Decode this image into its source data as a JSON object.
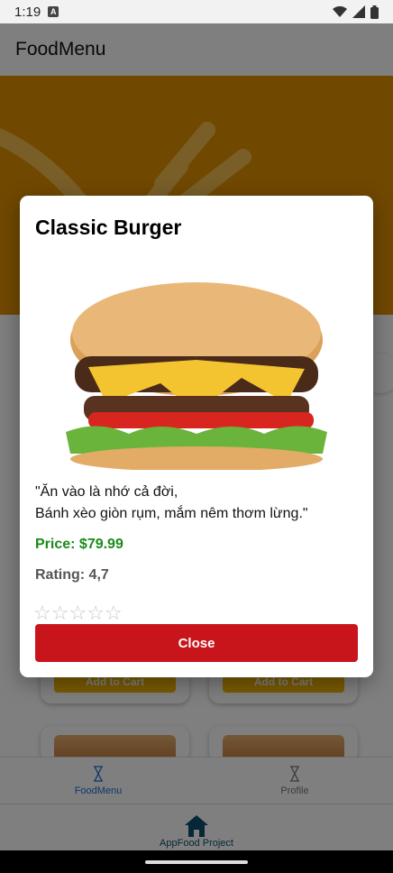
{
  "status_bar": {
    "time": "1:19",
    "notification_icon": "A"
  },
  "app_bar": {
    "title": "FoodMenu"
  },
  "background_cards": {
    "add_to_cart_label": "Add to Cart"
  },
  "tabs": [
    {
      "label": "FoodMenu",
      "icon": "hourglass-icon",
      "active": true
    },
    {
      "label": "Profile",
      "icon": "hourglass-icon",
      "active": false
    }
  ],
  "bottom_nav": {
    "label": "AppFood Project",
    "icon": "home-icon"
  },
  "modal": {
    "title": "Classic Burger",
    "description_line1": "\"Ăn vào là nhớ cả đời,",
    "description_line2": "Bánh xèo giòn rụm, mắm nêm thơm lừng.\"",
    "price": "Price: $79.99",
    "rating": "Rating: 4,7",
    "stars": [
      "☆",
      "☆",
      "☆",
      "☆",
      "☆"
    ],
    "close_label": "Close"
  },
  "colors": {
    "hero": "#e39100",
    "price": "#1a8a1a",
    "close_button": "#c8141b",
    "tab_active": "#1a6fd6",
    "cart_button": "#f5b700"
  }
}
